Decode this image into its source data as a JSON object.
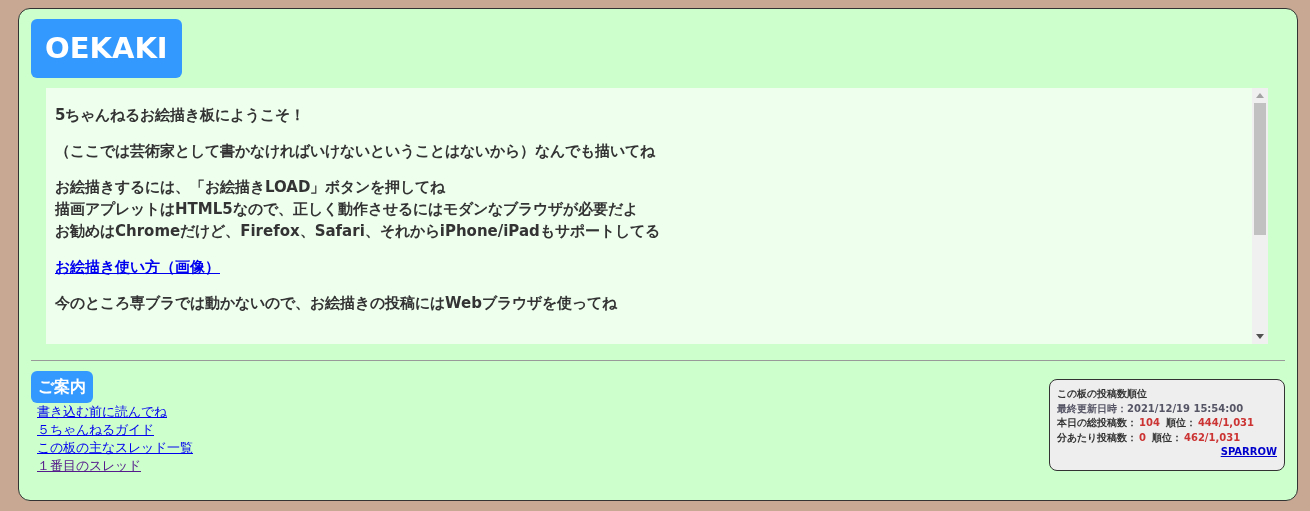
{
  "board_title": "OEKAKI",
  "intro": [
    {
      "kind": "text",
      "lines": [
        "5ちゃんねるお絵描き板にようこそ！"
      ]
    },
    {
      "kind": "text",
      "lines": [
        "（ここでは芸術家として書かなければいけないということはないから）なんでも描いてね"
      ]
    },
    {
      "kind": "text",
      "lines": [
        "お絵描きするには、「お絵描きLOAD」ボタンを押してね",
        "描画アプレットはHTML5なので、正しく動作させるにはモダンなブラウザが必要だよ",
        "お勧めはChromeだけど、Firefox、Safari、それからiPhone/iPadもサポートしてる"
      ]
    },
    {
      "kind": "link",
      "lines": [
        "お絵描き使い方（画像）"
      ]
    },
    {
      "kind": "text",
      "lines": [
        "今のところ専ブラでは動かないので、お絵描きの投稿にはWebブラウザを使ってね"
      ]
    }
  ],
  "guide": {
    "heading": "ご案内",
    "links": [
      {
        "label": "書き込む前に読んでね",
        "visited": false
      },
      {
        "label": "５ちゃんねるガイド",
        "visited": false
      },
      {
        "label": "この板の主なスレッド一覧",
        "visited": false
      },
      {
        "label": "１番目のスレッド",
        "visited": true
      }
    ]
  },
  "ranking": {
    "title": "この板の投稿数順位",
    "updated_label": "最終更新日時：",
    "updated": "2021/12/19 15:54:00",
    "rows": [
      {
        "label": "本日の総投稿数：",
        "count": "104",
        "rank_label": "順位：",
        "rank": "444/1,031"
      },
      {
        "label": "分あたり投稿数：",
        "count": "0",
        "rank_label": "順位：",
        "rank": "462/1,031"
      }
    ],
    "link": "SPARROW"
  }
}
